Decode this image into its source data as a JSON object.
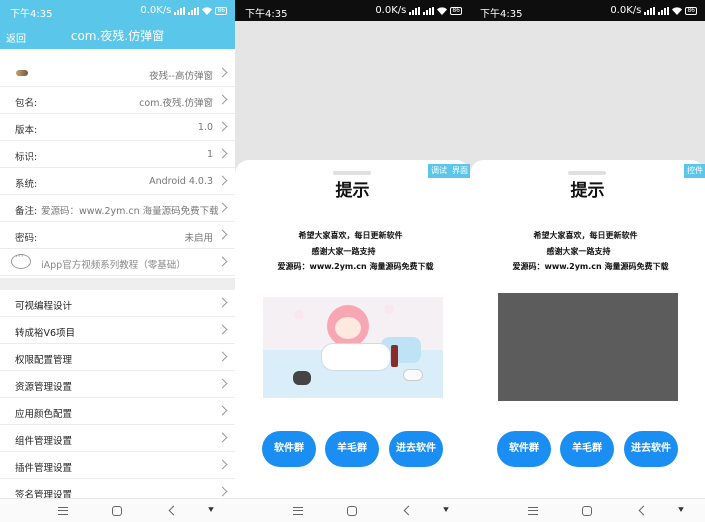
{
  "status": {
    "time": "下午4:35",
    "speed": "0.0K/s",
    "battery": "86"
  },
  "panel1": {
    "back_label": "返回",
    "title": "com.夜残.仿弹窗",
    "info_rows": [
      {
        "key": "",
        "value": "夜残--高仿弹窗"
      },
      {
        "key": "包名:",
        "value": "com.夜残.仿弹窗"
      },
      {
        "key": "版本:",
        "value": "1.0"
      },
      {
        "key": "标识:",
        "value": "1"
      },
      {
        "key": "系统:",
        "value": "Android 4.0.3"
      },
      {
        "key": "备注:",
        "value": "爱源码：www.2ym.cn 海量源码免费下载"
      },
      {
        "key": "密码:",
        "value": "未启用"
      },
      {
        "key": "",
        "value": "iApp官方视频系列教程（零基础）"
      }
    ],
    "menu_items": [
      "可视编程设计",
      "转成裕V6项目",
      "权限配置管理",
      "资源管理设置",
      "应用颜色配置",
      "组件管理设置",
      "插件管理设置",
      "签名管理设置"
    ]
  },
  "dialog": {
    "title": "提示",
    "lines": [
      "希望大家喜欢，每日更新软件",
      "感谢大家一路支持",
      "爱源码：www.2ym.cn 海量源码免费下载"
    ],
    "buttons": [
      "软件群",
      "羊毛群",
      "进去软件"
    ]
  },
  "panel2": {
    "tags": [
      "调试",
      "界面"
    ]
  },
  "panel3": {
    "tags": [
      "控件"
    ]
  }
}
